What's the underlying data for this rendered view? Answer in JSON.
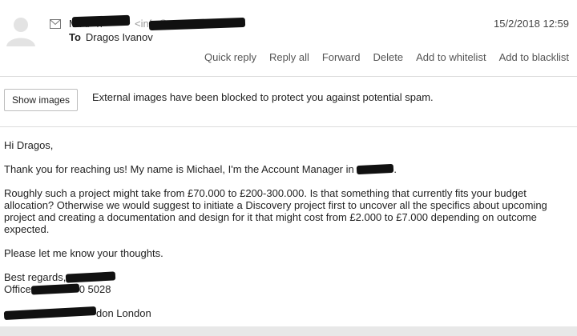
{
  "header": {
    "from_name": "M          AP  n",
    "from_email": "<info@                 >",
    "date": "15/2/2018 12:59",
    "to_label": "To",
    "to_name": "Dragos Ivanov"
  },
  "actions": [
    "Quick reply",
    "Reply all",
    "Forward",
    "Delete",
    "Add to whitelist",
    "Add to blacklist"
  ],
  "banner": {
    "button_label": "Show images",
    "message": "External images have been blocked to protect you against potential spam."
  },
  "body": {
    "greeting": "Hi Dragos,",
    "intro": "Thank you for reaching us! My name is Michael, I'm the Account Manager in",
    "intro_end": ".",
    "paragraph": "Roughly such a project might take from £70.000 to £200-300.000. Is that something that currently fits your budget allocation? Otherwise we would suggest to initiate a Discovery project first to uncover all the specifics about upcoming project and creating a documentation and design for it that might cost from £2.000 to £7.000 depending on outcome expected.",
    "closing": "Please let me know your thoughts.",
    "regards": "Best regards,",
    "office": "Office",
    "office_phone_tail": "0 5028",
    "address_tail": "don London"
  },
  "colors": {
    "redaction": "#111111",
    "border": "#dcdcdc",
    "muted": "#555555"
  }
}
